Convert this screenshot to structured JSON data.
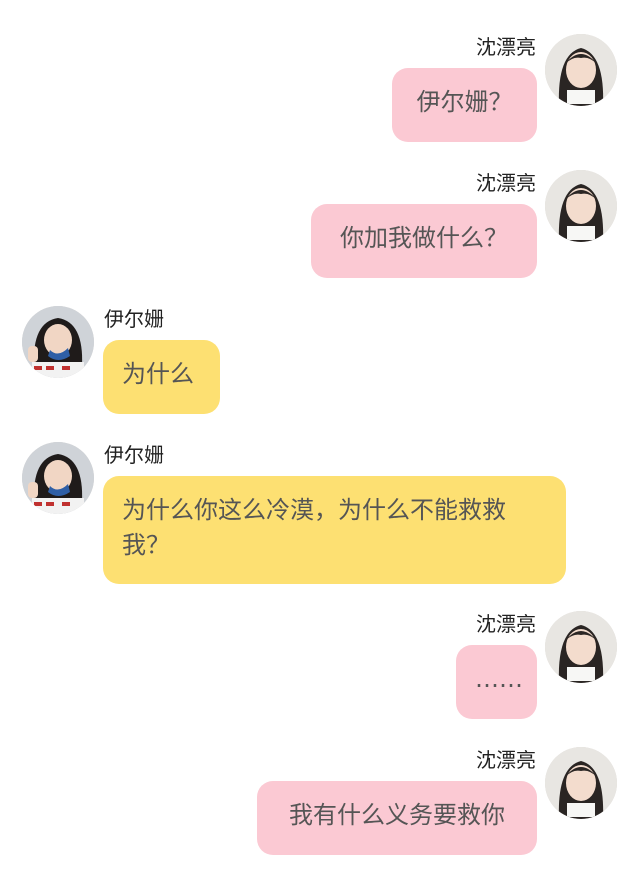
{
  "messages": [
    {
      "side": "right",
      "sender": "沈漂亮",
      "text": "伊尔姗？"
    },
    {
      "side": "right",
      "sender": "沈漂亮",
      "text": "你加我做什么？"
    },
    {
      "side": "left",
      "sender": "伊尔姗",
      "text": "为什么"
    },
    {
      "side": "left",
      "sender": "伊尔姗",
      "text": "为什么你这么冷漠，为什么不能救救我？"
    },
    {
      "side": "right",
      "sender": "沈漂亮",
      "text": "……"
    },
    {
      "side": "right",
      "sender": "沈漂亮",
      "text": "我有什么义务要救你"
    }
  ],
  "colors": {
    "right_bubble": "#fbc9d3",
    "left_bubble": "#fde072",
    "background": "#ffffff"
  }
}
